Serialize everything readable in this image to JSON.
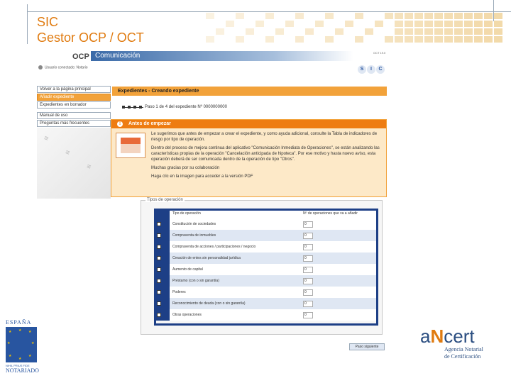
{
  "slide": {
    "title_line1": "SIC",
    "title_line2": "Gestor OCP / OCT",
    "accent": "#e07b10"
  },
  "app": {
    "logo": "OCP",
    "tab_label": "Comunicación",
    "version": "OCT 19.0",
    "user": "Usuario conectado: Notario",
    "sic_letters": [
      "S",
      "I",
      "C"
    ]
  },
  "sidebar": {
    "items": [
      {
        "label": "Volver a la página principal",
        "active": false
      },
      {
        "label": "Añadir expediente",
        "active": true
      },
      {
        "label": "Expedientes en borrador",
        "active": false
      },
      {
        "label": "Manual de uso",
        "active": false
      },
      {
        "label": "Preguntas más frecuentes",
        "active": false
      }
    ]
  },
  "main": {
    "title": "Expedientes - Creando expediente",
    "step_text": "Paso 1 de 4 del expediente Nº 0000000000"
  },
  "panel": {
    "heading": "Antes de empezar",
    "paragraphs": [
      "Le sugerimos que antes de empezar a crear el expediente, y como ayuda adicional, consulte la Tabla de indicadores de riesgo por tipo de operación.",
      "Dentro del proceso de mejora continua del aplicativo \"Comunicación Inmediata de Operaciones\", se están analizando las características propias de la operación \"Cancelación anticipada de hipoteca\". Por ese motivo y hasta nuevo aviso, esta operación deberá de ser comunicada dentro de la operación de tipo \"Otros\".",
      "Muchas gracias por su colaboración",
      "Haga clic en la imagen para acceder a la versión PDF"
    ]
  },
  "operations": {
    "legend": "Tipos de operación",
    "headers": [
      "Tipo de operación",
      "Nº de operaciones que va a añadir"
    ],
    "rows": [
      {
        "label": "Constitución de sociedades",
        "qty": "0"
      },
      {
        "label": "Compraventa de inmuebles",
        "qty": "0"
      },
      {
        "label": "Compraventa de acciones / participaciones / negocio",
        "qty": "0"
      },
      {
        "label": "Creación de entes sin personalidad jurídica",
        "qty": "0"
      },
      {
        "label": "Aumento de capital",
        "qty": "0"
      },
      {
        "label": "Préstamo (con o sin garantía)",
        "qty": "0"
      },
      {
        "label": "Poderes",
        "qty": "0"
      },
      {
        "label": "Reconocimiento de deuda (con o sin garantía)",
        "qty": "0"
      },
      {
        "label": "Otras operaciones",
        "qty": "0"
      }
    ],
    "next_button": "Paso siguiente"
  },
  "logos": {
    "spain_top": "ESPAÑA",
    "spain_motto": "NIHIL PRIUS FIDE",
    "spain_bottom": "NOTARIADO",
    "ancert_a": "a",
    "ancert_n": "N",
    "ancert_rest": "cert",
    "ancert_sub1": "Agencia Notarial",
    "ancert_sub2": "de Certificación"
  }
}
